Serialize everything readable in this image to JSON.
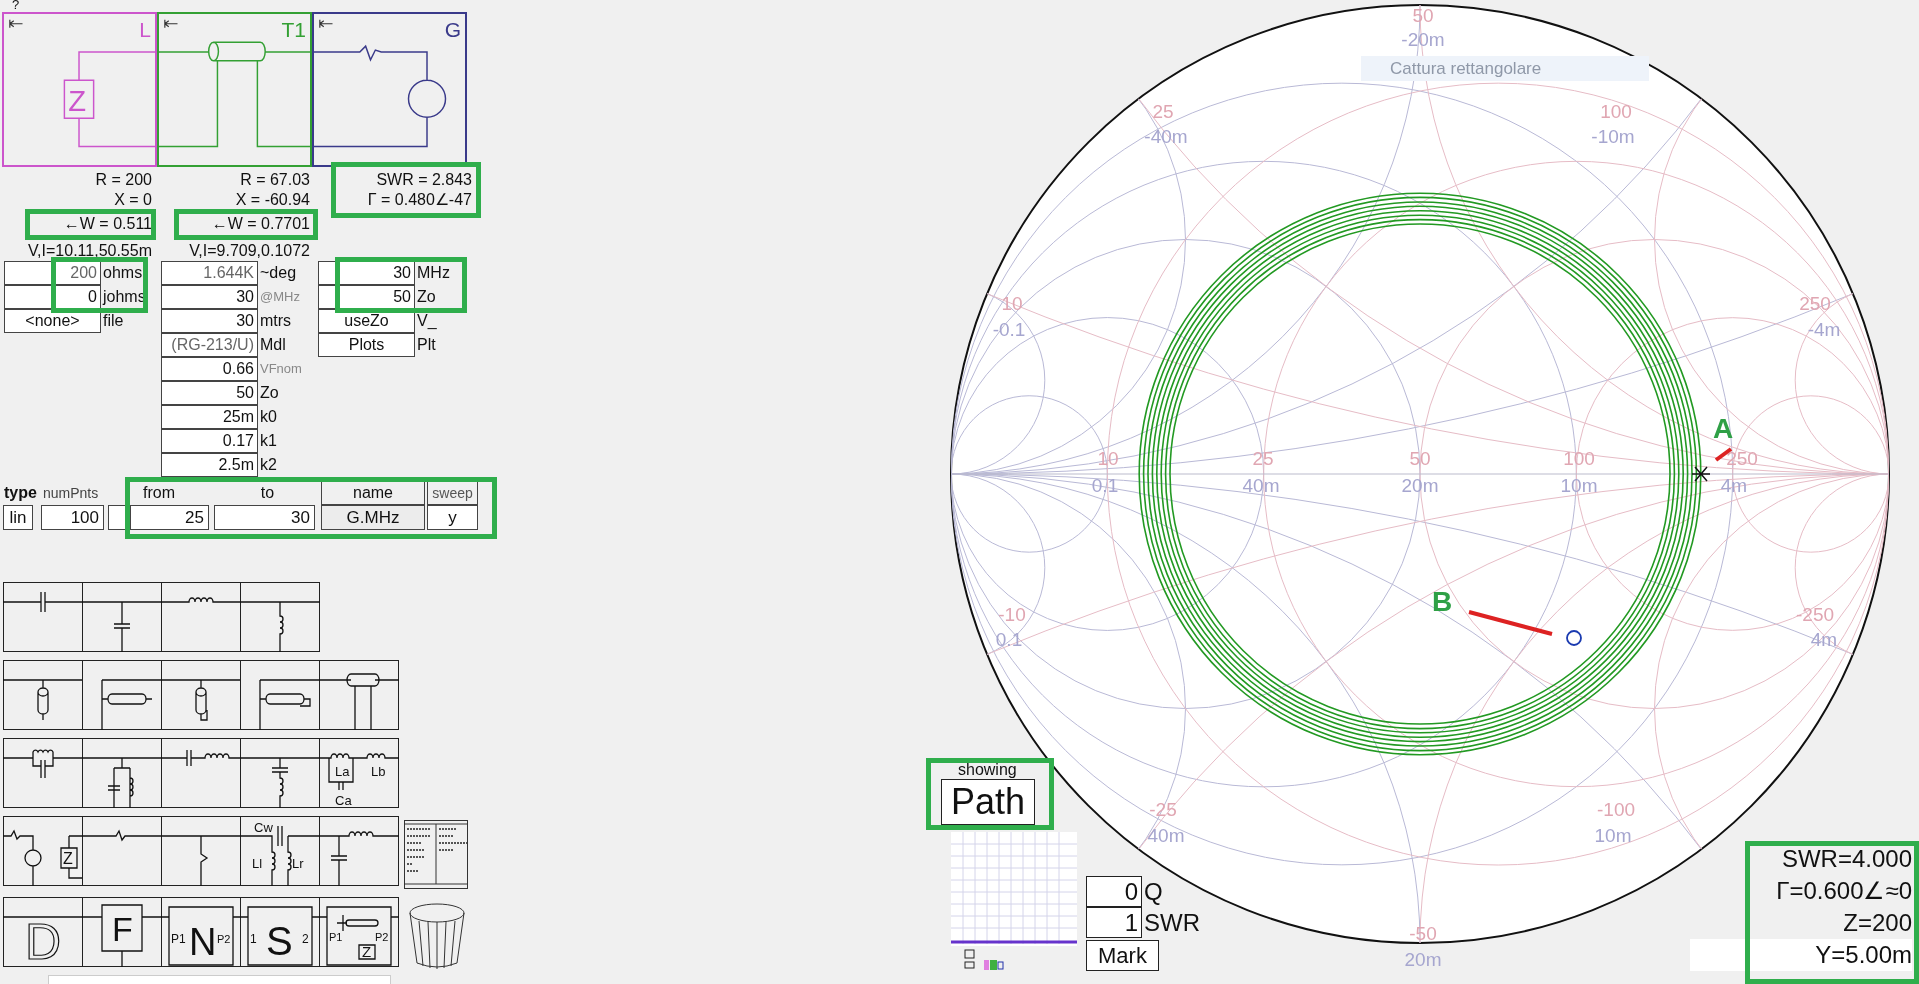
{
  "help_mark": "?",
  "circuit": [
    {
      "label": "L",
      "kind": "load",
      "color": "#cc55cc",
      "symbol": "Z"
    },
    {
      "label": "T1",
      "kind": "line",
      "color": "#33a033"
    },
    {
      "label": "G",
      "kind": "generator",
      "color": "#3a3a8a"
    }
  ],
  "readouts": [
    {
      "lines": [
        "R = 200",
        "X = 0"
      ],
      "power": "←W = 0.511",
      "vi": "V,I=10.11,50.55m"
    },
    {
      "lines": [
        "R = 67.03",
        "X = -60.94"
      ],
      "power": "←W = 0.7701",
      "vi": "V,I=9.709,0.1072"
    },
    {
      "lines": [
        "SWR = 2.843",
        "Γ = 0.480∠-47"
      ]
    }
  ],
  "load_fields": [
    {
      "value": "200",
      "unit": "ohms",
      "kind": "field",
      "dim": true,
      "unit_dim": false
    },
    {
      "value": "0",
      "unit": "johms",
      "kind": "field",
      "dim": false,
      "unit_dim": false
    },
    {
      "value": "<none>",
      "unit": "file",
      "kind": "button",
      "dim": false,
      "unit_dim": false
    }
  ],
  "line_fields": [
    {
      "value": "1.644K",
      "unit": "~deg",
      "kind": "field",
      "dim": true,
      "unit_dim": false
    },
    {
      "value": "30",
      "unit": "@MHz",
      "kind": "field",
      "dim": false,
      "unit_dim": true
    },
    {
      "value": "30",
      "unit": "mtrs",
      "kind": "field",
      "dim": false,
      "unit_dim": false
    },
    {
      "value": "(RG-213/U)",
      "unit": "Mdl",
      "kind": "field",
      "dim": true,
      "unit_dim": false
    },
    {
      "value": "0.66",
      "unit": "VFnom",
      "kind": "field",
      "dim": false,
      "unit_dim": true
    },
    {
      "value": "50",
      "unit": "Zo",
      "kind": "field",
      "dim": false,
      "unit_dim": false
    },
    {
      "value": "25m",
      "unit": "k0",
      "kind": "field",
      "dim": false,
      "unit_dim": false
    },
    {
      "value": "0.17",
      "unit": "k1",
      "kind": "field",
      "dim": false,
      "unit_dim": false
    },
    {
      "value": "2.5m",
      "unit": "k2",
      "kind": "field",
      "dim": false,
      "unit_dim": false
    }
  ],
  "gen_fields": [
    {
      "value": "30",
      "unit": "MHz",
      "kind": "field",
      "dim": false,
      "unit_dim": false
    },
    {
      "value": "50",
      "unit": "Zo",
      "kind": "field",
      "dim": false,
      "unit_dim": false
    },
    {
      "value": "useZo",
      "unit": "V_",
      "kind": "button",
      "dim": false,
      "unit_dim": false
    },
    {
      "value": "Plots",
      "unit": "Plt",
      "kind": "button",
      "dim": false,
      "unit_dim": false
    }
  ],
  "sweep": {
    "type_label": "type",
    "numpnts_label": "numPnts",
    "from_label": "from",
    "to_label": "to",
    "name_label": "name",
    "sweep_label": "sweep",
    "type": "lin",
    "num_points": "100",
    "from": "25",
    "to": "30",
    "name": "G.MHz",
    "sweep": "y"
  },
  "palette": [
    [
      {
        "kind": "series-capacitor"
      },
      {
        "kind": "shunt-capacitor"
      },
      {
        "kind": "series-inductor"
      },
      {
        "kind": "shunt-inductor"
      }
    ],
    [
      {
        "kind": "shunt-open-stub"
      },
      {
        "kind": "series-open-stub"
      },
      {
        "kind": "shunt-shorted-stub"
      },
      {
        "kind": "series-shorted-stub"
      },
      {
        "kind": "transmission-line"
      }
    ],
    [
      {
        "kind": "series-tank"
      },
      {
        "kind": "shunt-tank"
      },
      {
        "kind": "series-lc"
      },
      {
        "kind": "shunt-lc"
      },
      {
        "kind": "transformer",
        "labels": [
          "La",
          "Lb",
          "Ca"
        ]
      }
    ],
    [
      {
        "kind": "source-load",
        "labels": [
          "Z"
        ]
      },
      {
        "kind": "series-resistor"
      },
      {
        "kind": "shunt-resistor"
      },
      {
        "kind": "coupled-coils",
        "labels": [
          "Cw",
          "Ll",
          "Lr"
        ]
      },
      {
        "kind": "lowpass"
      }
    ],
    [
      {
        "kind": "d-block",
        "labels": [
          "D"
        ]
      },
      {
        "kind": "f-block",
        "labels": [
          "F"
        ]
      },
      {
        "kind": "n-port",
        "labels": [
          "P1",
          "N",
          "P2"
        ]
      },
      {
        "kind": "s-port",
        "labels": [
          "1",
          "S",
          "2"
        ]
      },
      {
        "kind": "network",
        "labels": [
          "P1",
          "P2",
          "Z"
        ]
      }
    ]
  ],
  "smith": {
    "capture_hint": "Cattura rettangolare",
    "scale_labels": [
      {
        "text": "50",
        "kind": "impedance"
      },
      {
        "text": "-20m",
        "kind": "admittance"
      },
      {
        "text": "25",
        "kind": "impedance"
      },
      {
        "text": "-40m",
        "kind": "admittance"
      },
      {
        "text": "100",
        "kind": "impedance"
      },
      {
        "text": "-10m",
        "kind": "admittance"
      },
      {
        "text": "10",
        "kind": "impedance"
      },
      {
        "text": "-0.1",
        "kind": "admittance"
      },
      {
        "text": "250",
        "kind": "impedance"
      },
      {
        "text": "-4m",
        "kind": "admittance"
      },
      {
        "text": "10",
        "kind": "impedance"
      },
      {
        "text": "0.1",
        "kind": "admittance"
      },
      {
        "text": "25",
        "kind": "impedance"
      },
      {
        "text": "40m",
        "kind": "admittance"
      },
      {
        "text": "50",
        "kind": "impedance"
      },
      {
        "text": "20m",
        "kind": "admittance"
      },
      {
        "text": "100",
        "kind": "impedance"
      },
      {
        "text": "10m",
        "kind": "admittance"
      },
      {
        "text": "250",
        "kind": "impedance"
      },
      {
        "text": "4m",
        "kind": "admittance"
      },
      {
        "text": "-10",
        "kind": "impedance"
      },
      {
        "text": "0.1",
        "kind": "admittance"
      },
      {
        "text": "-250",
        "kind": "impedance"
      },
      {
        "text": "4m",
        "kind": "admittance"
      },
      {
        "text": "-25",
        "kind": "impedance"
      },
      {
        "text": "40m",
        "kind": "admittance"
      },
      {
        "text": "-100",
        "kind": "impedance"
      },
      {
        "text": "10m",
        "kind": "admittance"
      },
      {
        "text": "-50",
        "kind": "impedance"
      },
      {
        "text": "20m",
        "kind": "admittance"
      }
    ],
    "annotations": [
      {
        "label": "A"
      },
      {
        "label": "B"
      }
    ]
  },
  "showing": {
    "label": "showing",
    "button": "Path"
  },
  "markers": [
    {
      "value": "0",
      "unit": "Q"
    },
    {
      "value": "1",
      "unit": "SWR"
    }
  ],
  "mark_button": "Mark",
  "result": [
    "SWR=4.000",
    "Γ=0.600∠≈0",
    "Z=200",
    "Y=5.00m"
  ]
}
